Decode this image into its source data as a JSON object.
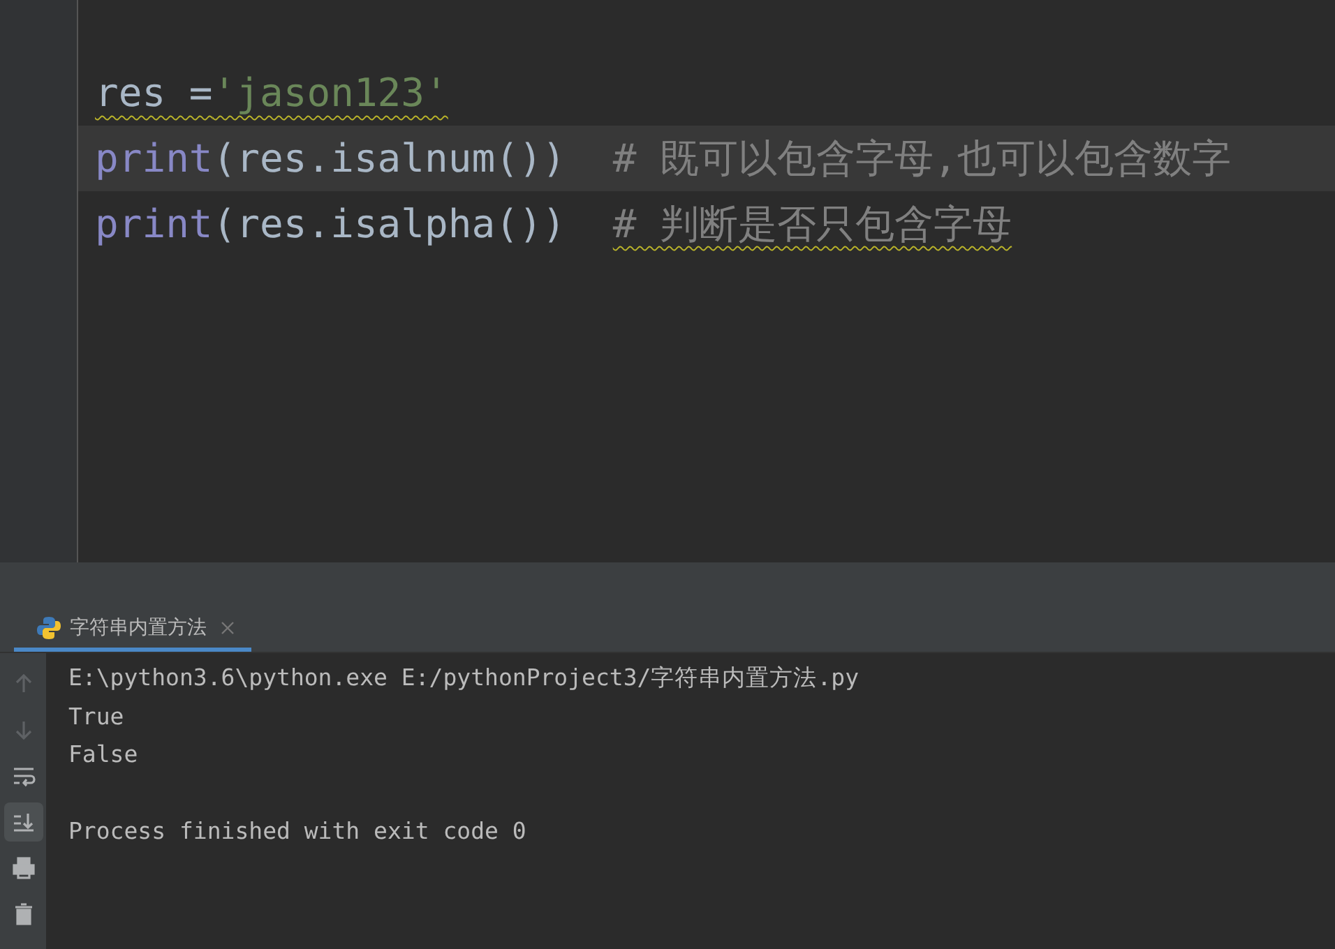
{
  "editor": {
    "lines": [
      {
        "current": false,
        "tokens": [
          {
            "kind": "plain",
            "text": "res =",
            "warned": true
          },
          {
            "kind": "string",
            "text": "'jason123'",
            "warned": true
          }
        ]
      },
      {
        "current": true,
        "tokens": [
          {
            "kind": "builtin",
            "text": "print",
            "warned": false
          },
          {
            "kind": "plain",
            "text": "(res.isalnum())  ",
            "warned": false
          },
          {
            "kind": "comment",
            "text": "# 既可以包含字母,也可以包含数字",
            "warned": false
          }
        ]
      },
      {
        "current": false,
        "tokens": [
          {
            "kind": "builtin",
            "text": "print",
            "warned": false
          },
          {
            "kind": "plain",
            "text": "(res.isalpha())  ",
            "warned": false
          },
          {
            "kind": "comment",
            "text": "# 判断是否只包含字母",
            "warned": true
          }
        ]
      }
    ]
  },
  "run_panel": {
    "tabs": [
      {
        "label": "字符串内置方法",
        "selected": true
      }
    ],
    "tools": [
      {
        "kind": "up",
        "disabled": true,
        "active": false
      },
      {
        "kind": "down",
        "disabled": true,
        "active": false
      },
      {
        "kind": "wrap",
        "disabled": false,
        "active": false
      },
      {
        "kind": "scroll-end",
        "disabled": false,
        "active": true
      },
      {
        "kind": "print",
        "disabled": false,
        "active": false
      },
      {
        "kind": "trash",
        "disabled": false,
        "active": false
      }
    ],
    "output": [
      {
        "kind": "stdout",
        "text": "E:\\python3.6\\python.exe E:/pythonProject3/字符串内置方法.py"
      },
      {
        "kind": "stdout",
        "text": "True"
      },
      {
        "kind": "stdout",
        "text": "False"
      },
      {
        "kind": "exit",
        "text": "Process finished with exit code 0"
      }
    ]
  }
}
